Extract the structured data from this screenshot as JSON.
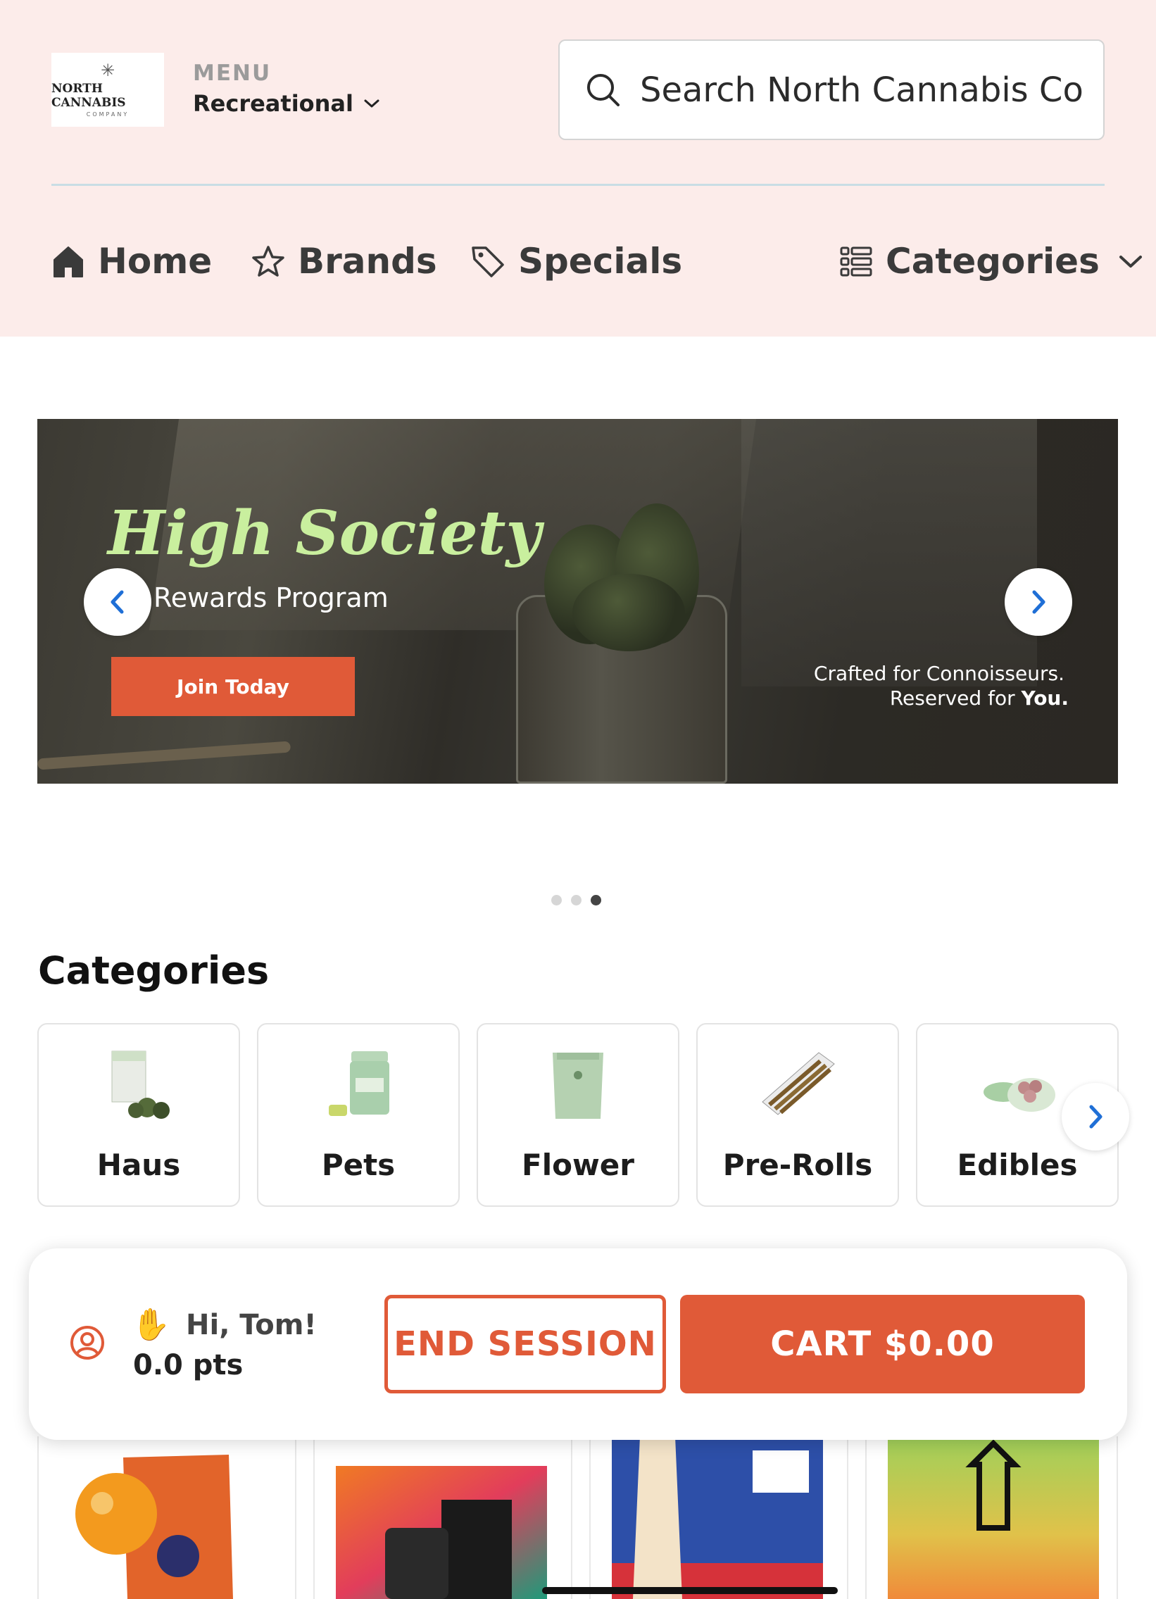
{
  "header": {
    "logo_text": "NORTH CANNABIS",
    "logo_subtext": "COMPANY",
    "menu_label": "MENU",
    "menu_value": "Recreational",
    "search_placeholder": "Search North Cannabis Co"
  },
  "nav": {
    "items": [
      {
        "label": "Home",
        "icon": "home-icon"
      },
      {
        "label": "Brands",
        "icon": "star-icon"
      },
      {
        "label": "Specials",
        "icon": "tag-icon"
      },
      {
        "label": "Categories",
        "icon": "list-icon"
      }
    ]
  },
  "banner": {
    "title": "High Society",
    "subtitle": "Rewards Program",
    "button_label": "Join Today",
    "tagline_line1": "Crafted for Connoisseurs.",
    "tagline_line2_prefix": "Reserved for ",
    "tagline_line2_bold": "You.",
    "slide_count": 3,
    "active_slide": 3
  },
  "categories": {
    "heading": "Categories",
    "items": [
      {
        "label": "Haus"
      },
      {
        "label": "Pets"
      },
      {
        "label": "Flower"
      },
      {
        "label": "Pre-Rolls"
      },
      {
        "label": "Edibles"
      }
    ]
  },
  "session_bar": {
    "greeting": "Hi, Tom!",
    "points": "0.0 pts",
    "end_session_label": "END SESSION",
    "cart_label": "CART $0.00"
  },
  "colors": {
    "header_bg": "#fcecea",
    "accent": "#e05a38",
    "banner_title": "#c9ef9e",
    "carousel_arrow": "#1f6fd6"
  }
}
